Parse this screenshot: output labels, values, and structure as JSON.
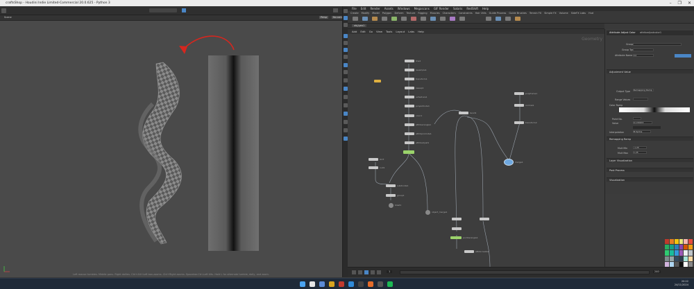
{
  "window": {
    "title": "craftsShop - Houdini Indie Limited-Commercial 20.0.625 - Python 3",
    "controls": [
      "–",
      "❐",
      "✕"
    ]
  },
  "viewport": {
    "tab_label": "Scene",
    "toggle_a": "Persp",
    "toggle_b": "No cam",
    "status_text": "Left mouse tumbles. Middle pans. Right dollies. Ctrl+Alt+Left box-zooms. Ctrl+Right zooms. Spacebar-Ctrl-Left tilts. Hold L for alternate tumble, dolly, and zoom."
  },
  "right_menu": [
    "File",
    "Edit",
    "Render",
    "Assets",
    "Windows",
    "Megascans",
    "GIF Render",
    "Solaris",
    "RedShift",
    "Help"
  ],
  "shelf_tabs": [
    "Create",
    "Modify",
    "Model",
    "Polygon",
    "Deform",
    "Texture",
    "Rigging",
    "Muscles",
    "Characters",
    "Constraints",
    "Hair Utils",
    "Guide Process",
    "Guide Brushes",
    "Terrain FX",
    "Simple FX",
    "Volume",
    "SideFX Labs",
    "Hud"
  ],
  "network": {
    "path": "obj/geo1",
    "menu": [
      "Add",
      "Edit",
      "Go",
      "View",
      "Tools",
      "Layout",
      "Labs",
      "Help"
    ],
    "context_label": "Geometry",
    "nodes_col1": [
      "line1",
      "resample1",
      "transform1",
      "sweep1",
      "uvtexture1",
      "polyextrude1",
      "color1",
      "attribwrangle1",
      "attribpromote1",
      "attribadjust1"
    ],
    "nodes_misc": [
      "bend1",
      "polyframe1",
      "normal1",
      "transform2",
      "merge1",
      "OUT",
      "null1",
      "subdivide1",
      "group1",
      "blast1",
      "object_merge1",
      "pointwrangle1",
      "attribcreate1"
    ]
  },
  "params": {
    "node_type": "Attribute Adjust Color",
    "node_name": "attribadjustcolor1",
    "sections": {
      "adjustment_value": "Adjustment Value",
      "remapping_ramp": "Remapping Ramp",
      "layer_visualization": "Layer Visualization",
      "post_process": "Post-Process",
      "visualization": "Visualization"
    },
    "labels": {
      "group": "Group",
      "group_type": "Group Type",
      "attribute_name": "Attribute Name",
      "output_type": "Output Type",
      "range_values": "Range Values",
      "ramp": "Color Ramp",
      "position": "Point No.",
      "value": "Value",
      "interpolation": "Interpolation",
      "min": "Mult Min",
      "max": "Mult Max"
    },
    "values": {
      "attribute": "Cd",
      "output_type": "Remapping Ramp",
      "interpolation": "B-Spline",
      "pos": "0.133673",
      "min": "-1.25",
      "max": "1.25"
    }
  },
  "timeline": {
    "frame": "1",
    "end": "240"
  },
  "taskbar": {
    "time": "20:22",
    "date": "24/11/2024"
  },
  "colors": {
    "accent_blue": "#4a86c6",
    "node_green": "#9bd36b",
    "annotation_red": "#d7261e"
  }
}
